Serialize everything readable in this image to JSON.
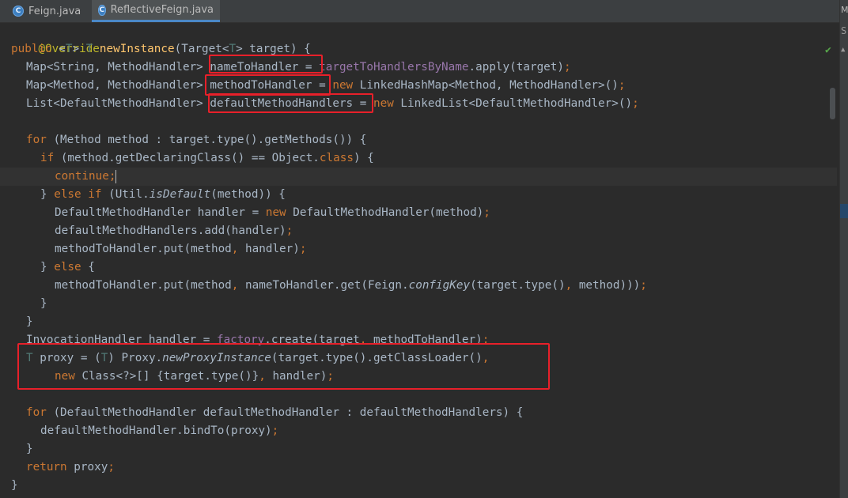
{
  "tabs": [
    {
      "label": "Feign.java",
      "icon": "java-class-icon",
      "active": false
    },
    {
      "label": "ReflectiveFeign.java",
      "icon": "java-class-icon",
      "active": true,
      "close": "×"
    }
  ],
  "right_panel": {
    "label": "M",
    "tool_glyph": "S",
    "arrow": "▲"
  },
  "editor": {
    "status_check": "✔",
    "code_lines": [
      "@Override",
      "public <T> T newInstance(Target<T> target) {",
      "  Map<String, MethodHandler> nameToHandler = targetToHandlersByName.apply(target);",
      "  Map<Method, MethodHandler> methodToHandler = new LinkedHashMap<Method, MethodHandler>();",
      "  List<DefaultMethodHandler> defaultMethodHandlers = new LinkedList<DefaultMethodHandler>();",
      "",
      "  for (Method method : target.type().getMethods()) {",
      "    if (method.getDeclaringClass() == Object.class) {",
      "      continue;",
      "    } else if (Util.isDefault(method)) {",
      "      DefaultMethodHandler handler = new DefaultMethodHandler(method);",
      "      defaultMethodHandlers.add(handler);",
      "      methodToHandler.put(method, handler);",
      "    } else {",
      "      methodToHandler.put(method, nameToHandler.get(Feign.configKey(target.type(), method)));",
      "    }",
      "  }",
      "  InvocationHandler handler = factory.create(target, methodToHandler);",
      "  T proxy = (T) Proxy.newProxyInstance(target.type().getClassLoader(),",
      "      new Class<?>[] {target.type()}, handler);",
      "",
      "  for (DefaultMethodHandler defaultMethodHandler : defaultMethodHandlers) {",
      "    defaultMethodHandler.bindTo(proxy);",
      "  }",
      "  return proxy;",
      "}"
    ]
  },
  "colors": {
    "background": "#2b2b2b",
    "keyword": "#cc7832",
    "annotation": "#bbb529",
    "method_decl": "#ffc66d",
    "field": "#9876aa",
    "default_text": "#a9b7c6",
    "highlight_box": "#e8202a"
  }
}
